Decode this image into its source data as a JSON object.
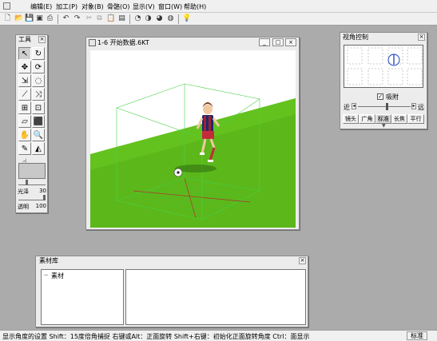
{
  "menu": {
    "items": [
      "编辑(E)",
      "加工(P)",
      "对象(B)",
      "骨骼(O)",
      "显示(V)",
      "窗口(W)",
      "帮助(H)"
    ]
  },
  "toolbox": {
    "title": "工具",
    "close": "×",
    "gloss_label": "光泽",
    "gloss_value": "30",
    "opacity_label": "透明",
    "opacity_value": "100",
    "gloss_level": 0.3,
    "opacity_level": 1.0
  },
  "document": {
    "title": "1-6 开始数据.6KT",
    "min": "_",
    "max": "□",
    "close": "×"
  },
  "view_panel": {
    "title": "视角控制",
    "close": "×",
    "checkbox_label": "吸附",
    "checkbox_checked": true,
    "near_label": "近",
    "far_label": "远",
    "tabs": [
      "镜头",
      "广角",
      "标准",
      "长焦",
      "平行"
    ],
    "active_tab": "标准"
  },
  "material_library": {
    "title": "素材库",
    "close": "×",
    "tree_items": [
      "素材"
    ]
  },
  "status": {
    "text": "显示角度的设置  Shift：15度倍角捕捉  右键或Alt：正面旋转  Shift+右键：初始化正面旋转角度  Ctrl：面显示",
    "mode": "标准"
  },
  "colors": {
    "ground": "#5cb81a",
    "grid": "#46d046",
    "app_bg": "#ababab"
  }
}
